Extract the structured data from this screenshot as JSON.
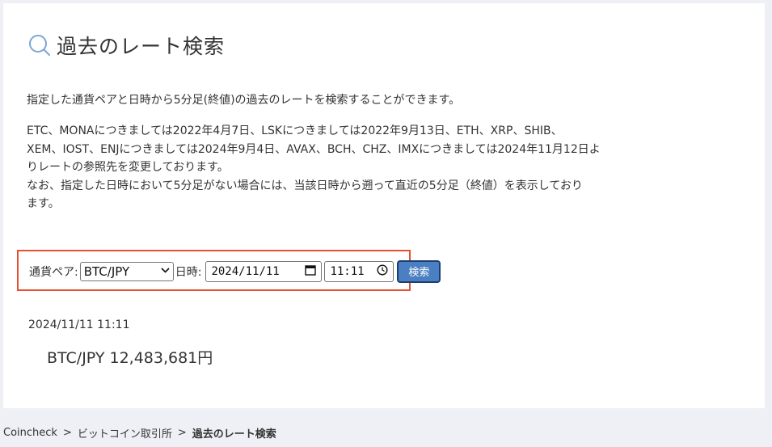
{
  "colors": {
    "accent": "#4a7fc1",
    "highlight_box": "#e3512f",
    "background": "#eef0f5"
  },
  "page": {
    "title": "過去のレート検索",
    "title_icon": "search-icon",
    "description_line1": "指定した通貨ペアと日時から5分足(終値)の過去のレートを検索することができます。",
    "description_block": [
      "ETC、MONAにつきましては2022年4月7日、LSKにつきましては2022年9月13日、ETH、XRP、SHIB、",
      "XEM、IOST、ENJにつきましては2024年9月4日、AVAX、BCH、CHZ、IMXにつきましては2024年11月12日よ",
      "りレートの参照先を変更しております。",
      "なお、指定した日時において5分足がない場合には、当該日時から遡って直近の5分足（終値）を表示しており",
      "ます。"
    ]
  },
  "form": {
    "pair_label": "通貨ペア:",
    "pair_value": "BTC/JPY",
    "datetime_label": "日時:",
    "date_value": "2024/11/11",
    "time_value": "11:11",
    "search_button": "検索"
  },
  "result": {
    "datetime": "2024/11/11 11:11",
    "rate": "BTC/JPY 12,483,681円"
  },
  "breadcrumb": {
    "items": [
      "Coincheck",
      "ビットコイン取引所",
      "過去のレート検索"
    ],
    "separator": ">"
  }
}
